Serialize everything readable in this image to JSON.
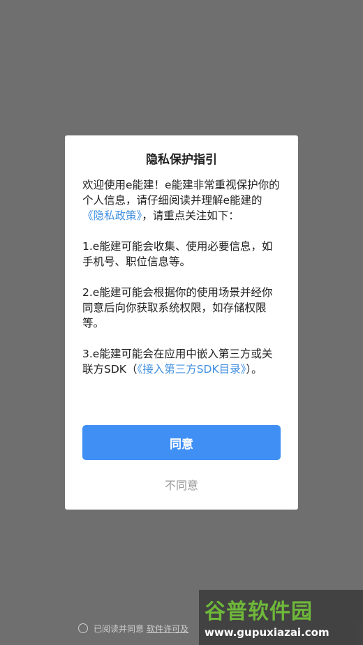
{
  "dialog": {
    "title": "隐私保护指引",
    "intro_prefix": "欢迎使用e能建！e能建非常重视保护你的个人信息，请仔细阅读并理解e能建的",
    "privacy_link": "《隐私政策》",
    "intro_suffix": "，请重点关注如下：",
    "item1": "1.e能建可能会收集、使用必要信息，如手机号、职位信息等。",
    "item2": "2.e能建可能会根据你的使用场景并经你同意后向你获取系统权限，如存储权限等。",
    "item3_prefix": "3.e能建可能会在应用中嵌入第三方或关联方SDK（",
    "sdk_link": "《接入第三方SDK目录》",
    "item3_suffix": "）。",
    "agree_label": "同意",
    "disagree_label": "不同意"
  },
  "footer": {
    "text": "已阅读并同意",
    "link": "软件许可及"
  },
  "watermark": {
    "logo": "谷普软件园",
    "url": "www.gupuxiazai.com"
  },
  "colors": {
    "overlay": "#6f6f6f",
    "accent": "#3f8ff5",
    "link": "#3f8fe0"
  }
}
